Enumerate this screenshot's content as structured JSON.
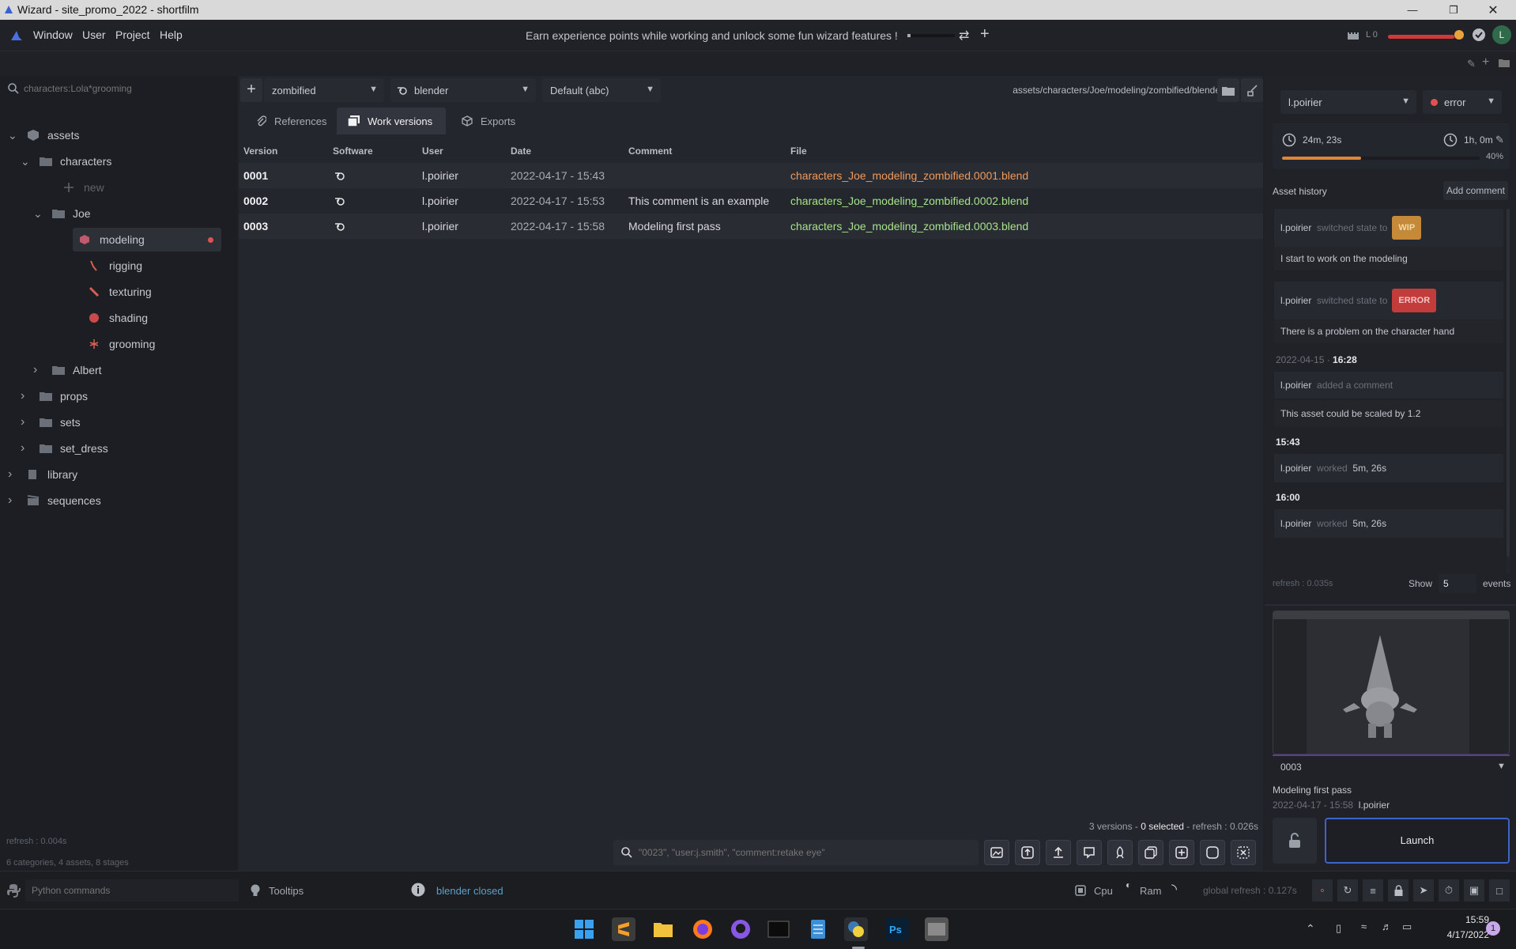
{
  "window": {
    "title": "Wizard - site_promo_2022 - shortfilm",
    "controls": [
      "minimize-icon",
      "restore-icon",
      "close-icon"
    ]
  },
  "menu": {
    "items": [
      "Window",
      "User",
      "Project",
      "Help"
    ],
    "xp_message": "Earn experience points while working and unlock some fun wizard features !",
    "level_label": "L 0",
    "avatar_letter": "L"
  },
  "left": {
    "search_placeholder": "characters:Lola*grooming",
    "tree": [
      {
        "label": "assets",
        "depth": 0,
        "expanded": true,
        "icon": "box-icon"
      },
      {
        "label": "characters",
        "depth": 1,
        "expanded": true,
        "icon": "folder-icon"
      },
      {
        "label": "new",
        "depth": 2,
        "icon": "plus-icon",
        "muted": true
      },
      {
        "label": "Joe",
        "depth": 2,
        "expanded": true,
        "icon": "folder-icon"
      },
      {
        "label": "modeling",
        "depth": 3,
        "icon": "modeling-icon",
        "selected": true,
        "status_dot": "#e05252"
      },
      {
        "label": "rigging",
        "depth": 3,
        "icon": "rigging-icon"
      },
      {
        "label": "texturing",
        "depth": 3,
        "icon": "texturing-icon"
      },
      {
        "label": "shading",
        "depth": 3,
        "icon": "shading-icon"
      },
      {
        "label": "grooming",
        "depth": 3,
        "icon": "grooming-icon"
      },
      {
        "label": "Albert",
        "depth": 2,
        "expanded": false,
        "icon": "folder-icon"
      },
      {
        "label": "props",
        "depth": 1,
        "expanded": false,
        "icon": "folder-icon"
      },
      {
        "label": "sets",
        "depth": 1,
        "expanded": false,
        "icon": "folder-icon"
      },
      {
        "label": "set_dress",
        "depth": 1,
        "expanded": false,
        "icon": "folder-icon"
      },
      {
        "label": "library",
        "depth": 0,
        "expanded": false,
        "icon": "book-icon"
      },
      {
        "label": "sequences",
        "depth": 0,
        "expanded": false,
        "icon": "clapper-icon"
      }
    ],
    "refresh": "refresh : 0.004s",
    "summary": "6 categories, 4 assets, 8 stages"
  },
  "center": {
    "variant": "zombified",
    "software": "blender",
    "export": "Default (abc)",
    "path": "assets/characters/Joe/modeling/zombified/blender",
    "tabs": [
      {
        "label": "References",
        "icon": "paperclip-icon"
      },
      {
        "label": "Work versions",
        "icon": "stack-icon",
        "active": true
      },
      {
        "label": "Exports",
        "icon": "cube-icon"
      }
    ],
    "columns": [
      "Version",
      "Software",
      "User",
      "Date",
      "Comment",
      "File"
    ],
    "rows": [
      {
        "version": "0001",
        "user": "l.poirier",
        "date": "2022-04-17 - 15:43",
        "comment": "",
        "file": "characters_Joe_modeling_zombified.0001.blend"
      },
      {
        "version": "0002",
        "user": "l.poirier",
        "date": "2022-04-17 - 15:53",
        "comment": "This comment is an example",
        "file": "characters_Joe_modeling_zombified.0002.blend"
      },
      {
        "version": "0003",
        "user": "l.poirier",
        "date": "2022-04-17 - 15:58",
        "comment": "Modeling first pass",
        "file": "characters_Joe_modeling_zombified.0003.blend"
      }
    ],
    "footer": {
      "versions": "3 versions - ",
      "selected": "0 selected",
      "refresh": " - refresh : 0.026s"
    },
    "search_placeholder": "\"0023\", \"user:j.smith\", \"comment:retake eye\""
  },
  "right": {
    "user": "l.poirier",
    "state": "error",
    "state_color": "#e05252",
    "time_spent": "24m, 23s",
    "estimated": "1h, 0m",
    "progress": 0.4,
    "progress_label": "40%",
    "history_title": "Asset history",
    "add_comment": "Add comment",
    "history": {
      "e1_user": "l.poirier",
      "e1_action": "switched state to",
      "e1_badge": "WIP",
      "e1_comment": "I start to work on the modeling",
      "e2_user": "l.poirier",
      "e2_action": "switched state to",
      "e2_badge": "ERROR",
      "e2_comment": "There is a problem on the character hand",
      "d1_date": "2022-04-15 · ",
      "d1_time": "16:28",
      "e3_user": "l.poirier",
      "e3_action": "added a comment",
      "e3_comment": "This asset could be scaled by 1.2",
      "t1": "15:43",
      "e4_user": "l.poirier",
      "e4_action": "worked",
      "e4_time": "5m, 26s",
      "t2": "16:00",
      "e5_user": "l.poirier",
      "e5_action": "worked",
      "e5_time": "5m, 26s"
    },
    "refresh": "refresh : 0.035s",
    "show_label": "Show",
    "show_value": "5",
    "events_label": "events",
    "selected_version": "0003",
    "version_comment": "Modeling first pass",
    "version_date": "2022-04-17 - 15:58",
    "version_user": "l.poirier",
    "launch": "Launch"
  },
  "status": {
    "python_placeholder": "Python commands",
    "tooltips": "Tooltips",
    "message": "blender closed",
    "cpu": "Cpu",
    "ram": "Ram",
    "global_refresh": "global refresh : 0.127s"
  },
  "taskbar": {
    "time": "15:59",
    "date": "4/17/2022",
    "notif": "1"
  }
}
